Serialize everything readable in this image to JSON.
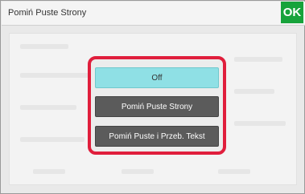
{
  "window": {
    "title": "Pomiń Puste Strony",
    "ok_label": "OK",
    "ok_color": "#17a33b"
  },
  "options": [
    {
      "label": "Off",
      "selected": true
    },
    {
      "label": "Pomiń Puste Strony",
      "selected": false
    },
    {
      "label": "Pomiń Puste i Przeb. Tekst",
      "selected": false
    }
  ],
  "colors": {
    "highlight": "#e01e3c",
    "selected_option": "#8fe0e5",
    "option": "#5b5b5b"
  }
}
